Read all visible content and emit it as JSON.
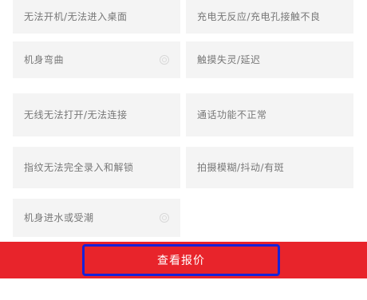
{
  "issues": {
    "r0c0": "无法开机/无法进入桌面",
    "r0c1": "充电无反应/充电孔接触不良",
    "r1c0": "机身弯曲",
    "r1c1": "触摸失灵/延迟",
    "r2c0": "无线无法打开/无法连接",
    "r2c1": "通话功能不正常",
    "r3c0": "指纹无法完全录入和解锁",
    "r3c1": "拍摄模糊/抖动/有斑",
    "r4c0": "机身进水或受潮"
  },
  "footer": {
    "quote_button": "查看报价"
  },
  "colors": {
    "accent": "#e8242b",
    "focus_outline": "#1622d8"
  }
}
